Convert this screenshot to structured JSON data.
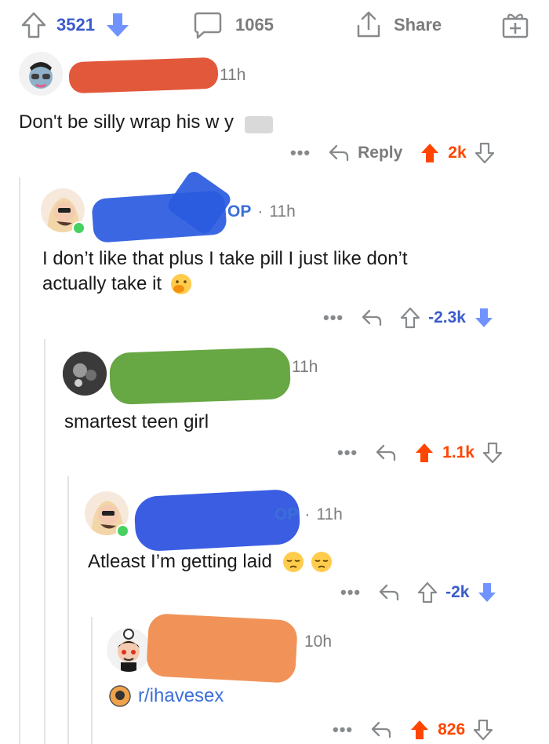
{
  "topbar": {
    "upvotes": "3521",
    "comments": "1065",
    "share_label": "Share"
  },
  "colors": {
    "upvote": "#ff4500",
    "downvote": "#7193ff",
    "neutral": "#878a8c",
    "upvote_count_color": "#3b5bcc",
    "online": "#46d160"
  },
  "comments": [
    {
      "time": "11h",
      "text": "Don't be silly wrap his w y",
      "reply_label": "Reply",
      "score": "2k",
      "vote_state": "up"
    },
    {
      "op_badge": "OP",
      "time": "11h",
      "text_line1": "I don’t like that plus I take pill I just like don’t",
      "text_line2": "actually take it",
      "score": "-2.3k",
      "vote_state": "down"
    },
    {
      "time": "11h",
      "text": "smartest teen girl",
      "score": "1.1k",
      "vote_state": "up"
    },
    {
      "op_badge": "OP",
      "time": "11h",
      "text": "Atleast I’m getting laid",
      "score": "-2k",
      "vote_state": "down"
    },
    {
      "time": "10h",
      "subreddit_link": "r/ihavesex",
      "score": "826",
      "vote_state": "up"
    }
  ],
  "icons": [
    "upvote-arrow-icon",
    "downvote-arrow-icon",
    "comment-bubble-icon",
    "share-icon",
    "gift-icon",
    "reply-arrow-icon",
    "more-dots-icon",
    "face-emoji-icon",
    "pensive-emoji-icon"
  ]
}
